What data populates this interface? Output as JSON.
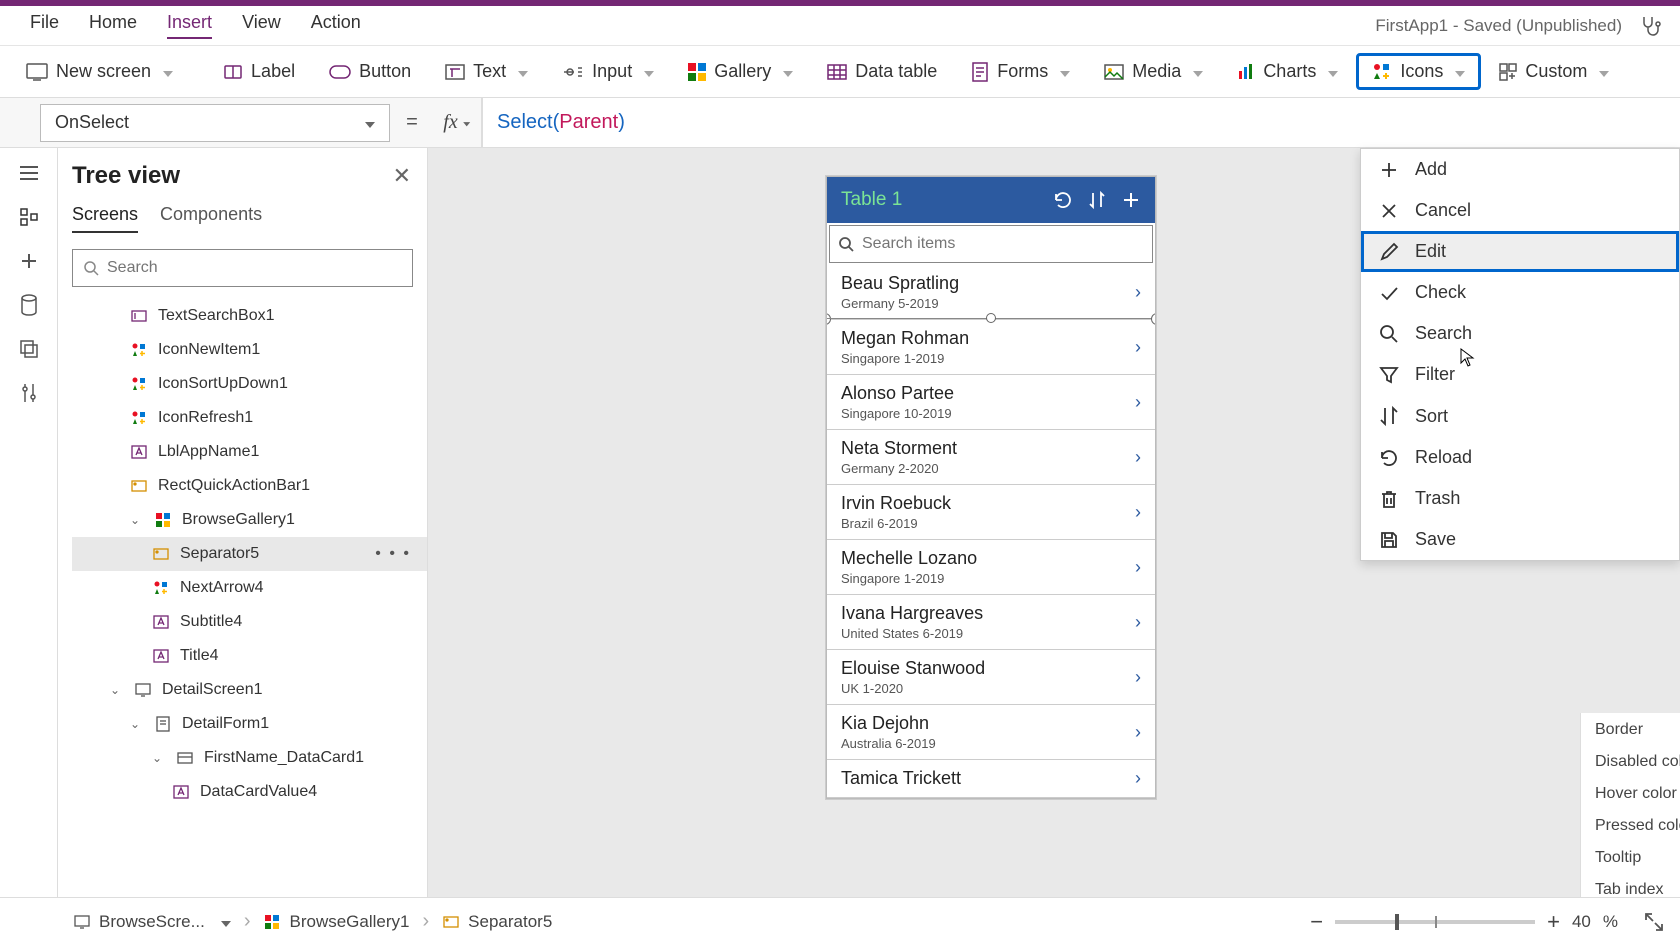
{
  "titlebar": {
    "menus": [
      "File",
      "Home",
      "Insert",
      "View",
      "Action"
    ],
    "active_menu_index": 2,
    "app_status": "FirstApp1 - Saved (Unpublished)"
  },
  "ribbon": {
    "new_screen": "New screen",
    "label": "Label",
    "button": "Button",
    "text": "Text",
    "input": "Input",
    "gallery": "Gallery",
    "datatable": "Data table",
    "forms": "Forms",
    "media": "Media",
    "charts": "Charts",
    "icons": "Icons",
    "custom": "Custom"
  },
  "formula": {
    "property": "OnSelect",
    "fn": "Select",
    "arg": "Parent"
  },
  "tree": {
    "title": "Tree view",
    "tabs": [
      "Screens",
      "Components"
    ],
    "active_tab_index": 0,
    "search_placeholder": "Search",
    "items": [
      {
        "label": "TextSearchBox1",
        "indent": 2,
        "icon": "textbox"
      },
      {
        "label": "IconNewItem1",
        "indent": 2,
        "icon": "iconplus"
      },
      {
        "label": "IconSortUpDown1",
        "indent": 2,
        "icon": "iconplus"
      },
      {
        "label": "IconRefresh1",
        "indent": 2,
        "icon": "iconplus"
      },
      {
        "label": "LblAppName1",
        "indent": 2,
        "icon": "label"
      },
      {
        "label": "RectQuickActionBar1",
        "indent": 2,
        "icon": "rect"
      },
      {
        "label": "BrowseGallery1",
        "indent": 2,
        "icon": "gallery",
        "expandable": true,
        "expanded": true
      },
      {
        "label": "Separator5",
        "indent": 3,
        "icon": "rect",
        "selected": true,
        "more": true
      },
      {
        "label": "NextArrow4",
        "indent": 3,
        "icon": "iconplus"
      },
      {
        "label": "Subtitle4",
        "indent": 3,
        "icon": "label"
      },
      {
        "label": "Title4",
        "indent": 3,
        "icon": "label"
      },
      {
        "label": "DetailScreen1",
        "indent": 1,
        "icon": "screen",
        "expandable": true,
        "expanded": true
      },
      {
        "label": "DetailForm1",
        "indent": 2,
        "icon": "form",
        "expandable": true,
        "expanded": true
      },
      {
        "label": "FirstName_DataCard1",
        "indent": 3,
        "icon": "card",
        "expandable": true,
        "expanded": true
      },
      {
        "label": "DataCardValue4",
        "indent": 4,
        "icon": "label"
      }
    ]
  },
  "phone": {
    "title": "Table 1",
    "search_placeholder": "Search items",
    "rows": [
      {
        "name": "Beau Spratling",
        "sub": "Germany 5-2019"
      },
      {
        "name": "Megan Rohman",
        "sub": "Singapore 1-2019"
      },
      {
        "name": "Alonso Partee",
        "sub": "Singapore 10-2019"
      },
      {
        "name": "Neta Storment",
        "sub": "Germany 2-2020"
      },
      {
        "name": "Irvin Roebuck",
        "sub": "Brazil 6-2019"
      },
      {
        "name": "Mechelle Lozano",
        "sub": "Singapore 1-2019"
      },
      {
        "name": "Ivana Hargreaves",
        "sub": "United States 6-2019"
      },
      {
        "name": "Elouise Stanwood",
        "sub": "UK 1-2020"
      },
      {
        "name": "Kia Dejohn",
        "sub": "Australia 6-2019"
      },
      {
        "name": "Tamica Trickett",
        "sub": ""
      }
    ]
  },
  "icons_menu": {
    "items": [
      {
        "icon": "plus",
        "label": "Add"
      },
      {
        "icon": "x",
        "label": "Cancel"
      },
      {
        "icon": "pencil",
        "label": "Edit",
        "highlighted": true,
        "hovered": true
      },
      {
        "icon": "check",
        "label": "Check"
      },
      {
        "icon": "search",
        "label": "Search"
      },
      {
        "icon": "filter",
        "label": "Filter"
      },
      {
        "icon": "sort",
        "label": "Sort"
      },
      {
        "icon": "reload",
        "label": "Reload"
      },
      {
        "icon": "trash",
        "label": "Trash"
      },
      {
        "icon": "save",
        "label": "Save"
      }
    ]
  },
  "props": [
    "Border",
    "Disabled color",
    "Hover color",
    "Pressed color",
    "Tooltip",
    "Tab index"
  ],
  "breadcrumbs": [
    {
      "label": "BrowseScre...",
      "icon": "screen",
      "dropdown": true
    },
    {
      "label": "BrowseGallery1",
      "icon": "gallery"
    },
    {
      "label": "Separator5",
      "icon": "rect"
    }
  ],
  "zoom": {
    "percent": "40",
    "unit": "%"
  }
}
